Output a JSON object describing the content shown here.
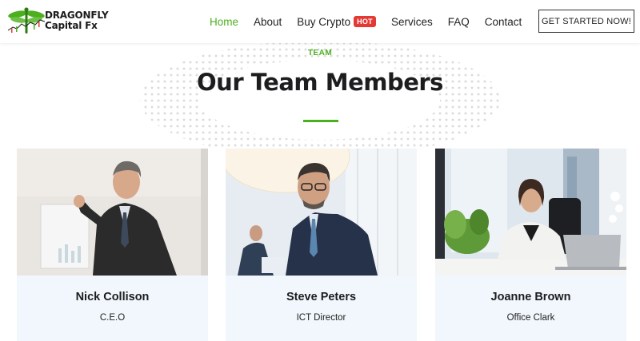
{
  "brand": {
    "line1": "DRAGONFLY",
    "line2": "Capital Fx"
  },
  "nav": {
    "home": "Home",
    "about": "About",
    "buy_crypto": "Buy Crypto",
    "hot_badge": "HOT",
    "services": "Services",
    "faq": "FAQ",
    "contact": "Contact"
  },
  "cta_label": "GET STARTED NOW!",
  "section": {
    "kicker": "TEAM",
    "title": "Our Team Members"
  },
  "team": [
    {
      "name": "Nick Collison",
      "role": "C.E.O"
    },
    {
      "name": "Steve Peters",
      "role": "ICT Director"
    },
    {
      "name": "Joanne Brown",
      "role": "Office Clark"
    }
  ],
  "colors": {
    "accent": "#4caf1f",
    "badge": "#e53935",
    "card_bg": "#f1f7fc",
    "text": "#1d1d1f"
  },
  "icons": [
    "dragonfly-logo-icon"
  ]
}
